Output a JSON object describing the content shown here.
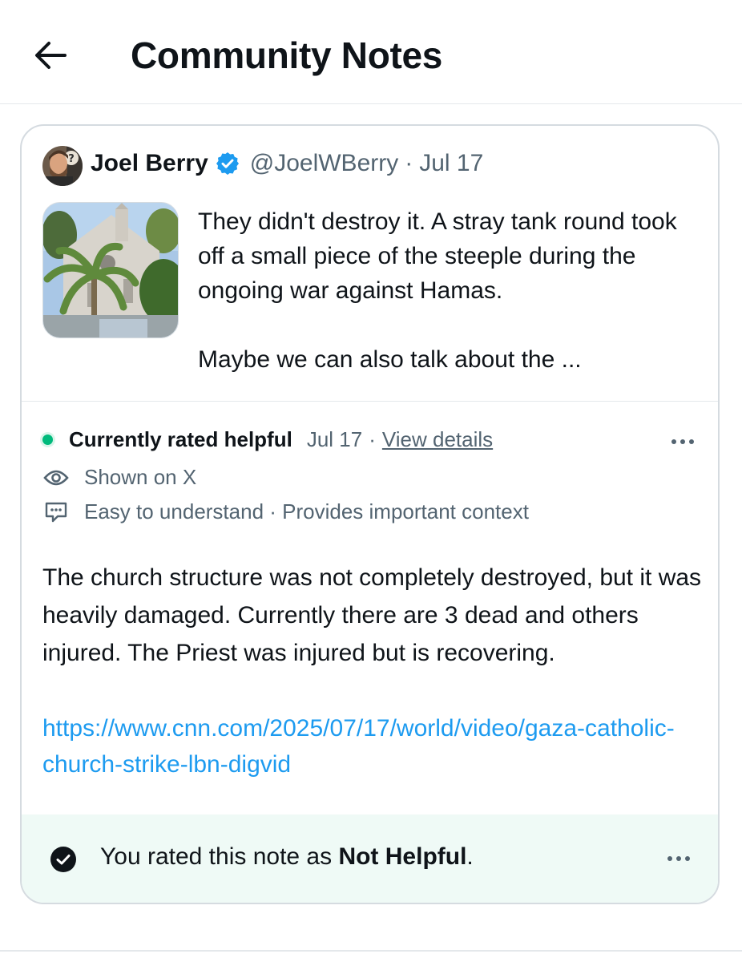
{
  "header": {
    "title": "Community Notes",
    "back_icon": "arrow-left-icon"
  },
  "tweet": {
    "author_name": "Joel Berry",
    "handle": "@JoelWBerry",
    "separator": "·",
    "date": "Jul 17",
    "verified_icon": "verified-badge-icon",
    "text_line1": "They didn't destroy it. A stray tank round took off a small piece of the steeple during the ongoing war against Hamas.",
    "text_line2": "Maybe we can also talk about the ..."
  },
  "note": {
    "status_label": "Currently rated helpful",
    "status_date": "Jul 17",
    "separator": "·",
    "view_details": "View details",
    "shown_on": "Shown on X",
    "reasons": "Easy to understand · Provides important context",
    "body": "The church structure was not completely destroyed, but it was heavily damaged. Currently there are 3 dead and others injured. The Priest was injured but is recovering.",
    "link": "https://www.cnn.com/2025/07/17/world/video/gaza-catholic-church-strike-lbn-digvid"
  },
  "rating": {
    "prefix": "You rated this note as ",
    "value": "Not Helpful",
    "suffix": "."
  },
  "colors": {
    "accent_link": "#1d9bf0",
    "helpful_green": "#00ba7c",
    "rating_bg": "#effaf6",
    "muted_text": "#536471"
  }
}
